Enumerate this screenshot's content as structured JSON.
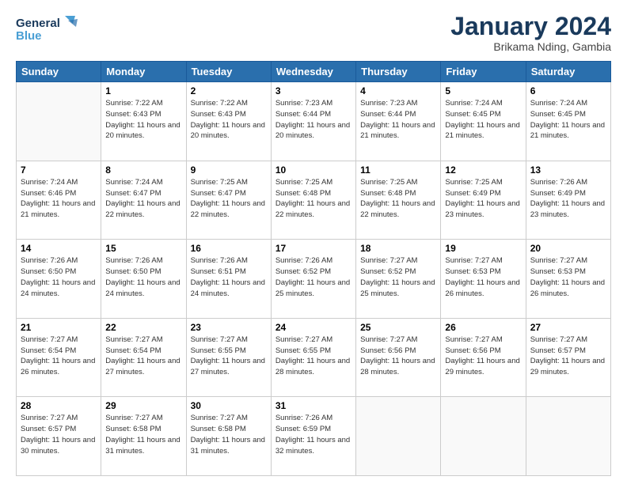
{
  "header": {
    "logo_line1": "General",
    "logo_line2": "Blue",
    "month": "January 2024",
    "location": "Brikama Nding, Gambia"
  },
  "days_of_week": [
    "Sunday",
    "Monday",
    "Tuesday",
    "Wednesday",
    "Thursday",
    "Friday",
    "Saturday"
  ],
  "weeks": [
    [
      {
        "day": "",
        "info": ""
      },
      {
        "day": "1",
        "info": "Sunrise: 7:22 AM\nSunset: 6:43 PM\nDaylight: 11 hours\nand 20 minutes."
      },
      {
        "day": "2",
        "info": "Sunrise: 7:22 AM\nSunset: 6:43 PM\nDaylight: 11 hours\nand 20 minutes."
      },
      {
        "day": "3",
        "info": "Sunrise: 7:23 AM\nSunset: 6:44 PM\nDaylight: 11 hours\nand 20 minutes."
      },
      {
        "day": "4",
        "info": "Sunrise: 7:23 AM\nSunset: 6:44 PM\nDaylight: 11 hours\nand 21 minutes."
      },
      {
        "day": "5",
        "info": "Sunrise: 7:24 AM\nSunset: 6:45 PM\nDaylight: 11 hours\nand 21 minutes."
      },
      {
        "day": "6",
        "info": "Sunrise: 7:24 AM\nSunset: 6:45 PM\nDaylight: 11 hours\nand 21 minutes."
      }
    ],
    [
      {
        "day": "7",
        "info": "Sunrise: 7:24 AM\nSunset: 6:46 PM\nDaylight: 11 hours\nand 21 minutes."
      },
      {
        "day": "8",
        "info": "Sunrise: 7:24 AM\nSunset: 6:47 PM\nDaylight: 11 hours\nand 22 minutes."
      },
      {
        "day": "9",
        "info": "Sunrise: 7:25 AM\nSunset: 6:47 PM\nDaylight: 11 hours\nand 22 minutes."
      },
      {
        "day": "10",
        "info": "Sunrise: 7:25 AM\nSunset: 6:48 PM\nDaylight: 11 hours\nand 22 minutes."
      },
      {
        "day": "11",
        "info": "Sunrise: 7:25 AM\nSunset: 6:48 PM\nDaylight: 11 hours\nand 22 minutes."
      },
      {
        "day": "12",
        "info": "Sunrise: 7:25 AM\nSunset: 6:49 PM\nDaylight: 11 hours\nand 23 minutes."
      },
      {
        "day": "13",
        "info": "Sunrise: 7:26 AM\nSunset: 6:49 PM\nDaylight: 11 hours\nand 23 minutes."
      }
    ],
    [
      {
        "day": "14",
        "info": "Sunrise: 7:26 AM\nSunset: 6:50 PM\nDaylight: 11 hours\nand 24 minutes."
      },
      {
        "day": "15",
        "info": "Sunrise: 7:26 AM\nSunset: 6:50 PM\nDaylight: 11 hours\nand 24 minutes."
      },
      {
        "day": "16",
        "info": "Sunrise: 7:26 AM\nSunset: 6:51 PM\nDaylight: 11 hours\nand 24 minutes."
      },
      {
        "day": "17",
        "info": "Sunrise: 7:26 AM\nSunset: 6:52 PM\nDaylight: 11 hours\nand 25 minutes."
      },
      {
        "day": "18",
        "info": "Sunrise: 7:27 AM\nSunset: 6:52 PM\nDaylight: 11 hours\nand 25 minutes."
      },
      {
        "day": "19",
        "info": "Sunrise: 7:27 AM\nSunset: 6:53 PM\nDaylight: 11 hours\nand 26 minutes."
      },
      {
        "day": "20",
        "info": "Sunrise: 7:27 AM\nSunset: 6:53 PM\nDaylight: 11 hours\nand 26 minutes."
      }
    ],
    [
      {
        "day": "21",
        "info": "Sunrise: 7:27 AM\nSunset: 6:54 PM\nDaylight: 11 hours\nand 26 minutes."
      },
      {
        "day": "22",
        "info": "Sunrise: 7:27 AM\nSunset: 6:54 PM\nDaylight: 11 hours\nand 27 minutes."
      },
      {
        "day": "23",
        "info": "Sunrise: 7:27 AM\nSunset: 6:55 PM\nDaylight: 11 hours\nand 27 minutes."
      },
      {
        "day": "24",
        "info": "Sunrise: 7:27 AM\nSunset: 6:55 PM\nDaylight: 11 hours\nand 28 minutes."
      },
      {
        "day": "25",
        "info": "Sunrise: 7:27 AM\nSunset: 6:56 PM\nDaylight: 11 hours\nand 28 minutes."
      },
      {
        "day": "26",
        "info": "Sunrise: 7:27 AM\nSunset: 6:56 PM\nDaylight: 11 hours\nand 29 minutes."
      },
      {
        "day": "27",
        "info": "Sunrise: 7:27 AM\nSunset: 6:57 PM\nDaylight: 11 hours\nand 29 minutes."
      }
    ],
    [
      {
        "day": "28",
        "info": "Sunrise: 7:27 AM\nSunset: 6:57 PM\nDaylight: 11 hours\nand 30 minutes."
      },
      {
        "day": "29",
        "info": "Sunrise: 7:27 AM\nSunset: 6:58 PM\nDaylight: 11 hours\nand 31 minutes."
      },
      {
        "day": "30",
        "info": "Sunrise: 7:27 AM\nSunset: 6:58 PM\nDaylight: 11 hours\nand 31 minutes."
      },
      {
        "day": "31",
        "info": "Sunrise: 7:26 AM\nSunset: 6:59 PM\nDaylight: 11 hours\nand 32 minutes."
      },
      {
        "day": "",
        "info": ""
      },
      {
        "day": "",
        "info": ""
      },
      {
        "day": "",
        "info": ""
      }
    ]
  ]
}
